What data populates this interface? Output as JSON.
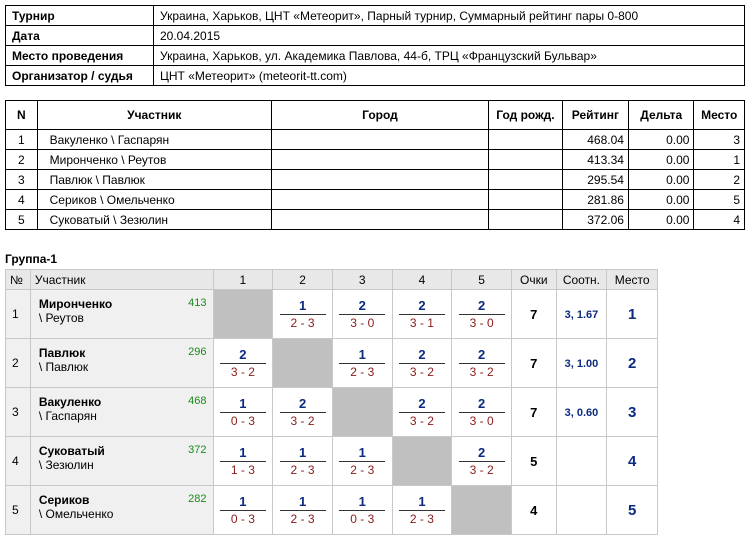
{
  "info": [
    {
      "label": "Турнир",
      "value": "Украина, Харьков, ЦНТ «Метеорит», Парный турнир, Суммарный рейтинг пары 0-800"
    },
    {
      "label": "Дата",
      "value": "20.04.2015"
    },
    {
      "label": "Место проведения",
      "value": "Украина, Харьков, ул. Академика Павлова, 44-б, ТРЦ «Французский Бульвар»"
    },
    {
      "label": "Организатор / судья",
      "value": "ЦНТ «Метеорит» (meteorit-tt.com)"
    }
  ],
  "participants": {
    "headers": [
      "N",
      "Участник",
      "Город",
      "Год рожд.",
      "Рейтинг",
      "Дельта",
      "Место"
    ],
    "rows": [
      {
        "n": "1",
        "name": "Вакуленко \\ Гаспарян",
        "city": "",
        "year": "",
        "rating": "468.04",
        "delta": "0.00",
        "place": "3"
      },
      {
        "n": "2",
        "name": "Миронченко \\ Реутов",
        "city": "",
        "year": "",
        "rating": "413.34",
        "delta": "0.00",
        "place": "1"
      },
      {
        "n": "3",
        "name": "Павлюк \\ Павлюк",
        "city": "",
        "year": "",
        "rating": "295.54",
        "delta": "0.00",
        "place": "2"
      },
      {
        "n": "4",
        "name": "Сериков \\ Омельченко",
        "city": "",
        "year": "",
        "rating": "281.86",
        "delta": "0.00",
        "place": "5"
      },
      {
        "n": "5",
        "name": "Суковатый \\ Зезюлин",
        "city": "",
        "year": "",
        "rating": "372.06",
        "delta": "0.00",
        "place": "4"
      }
    ]
  },
  "group": {
    "title": "Группа-1",
    "headers": [
      "№",
      "Участник",
      "1",
      "2",
      "3",
      "4",
      "5",
      "Очки",
      "Соотн.",
      "Место"
    ],
    "rows": [
      {
        "n": "1",
        "surname": "Миронченко",
        "partner": "\\ Реутов",
        "rating": "413",
        "results": [
          null,
          {
            "w": "1",
            "s": "2 - 3"
          },
          {
            "w": "2",
            "s": "3 - 0"
          },
          {
            "w": "2",
            "s": "3 - 1"
          },
          {
            "w": "2",
            "s": "3 - 0"
          }
        ],
        "points": "7",
        "ratio": "3, 1.67",
        "place": "1"
      },
      {
        "n": "2",
        "surname": "Павлюк",
        "partner": "\\ Павлюк",
        "rating": "296",
        "results": [
          {
            "w": "2",
            "s": "3 - 2"
          },
          null,
          {
            "w": "1",
            "s": "2 - 3"
          },
          {
            "w": "2",
            "s": "3 - 2"
          },
          {
            "w": "2",
            "s": "3 - 2"
          }
        ],
        "points": "7",
        "ratio": "3, 1.00",
        "place": "2"
      },
      {
        "n": "3",
        "surname": "Вакуленко",
        "partner": "\\ Гаспарян",
        "rating": "468",
        "results": [
          {
            "w": "1",
            "s": "0 - 3"
          },
          {
            "w": "2",
            "s": "3 - 2"
          },
          null,
          {
            "w": "2",
            "s": "3 - 2"
          },
          {
            "w": "2",
            "s": "3 - 0"
          }
        ],
        "points": "7",
        "ratio": "3, 0.60",
        "place": "3"
      },
      {
        "n": "4",
        "surname": "Суковатый",
        "partner": "\\ Зезюлин",
        "rating": "372",
        "results": [
          {
            "w": "1",
            "s": "1 - 3"
          },
          {
            "w": "1",
            "s": "2 - 3"
          },
          {
            "w": "1",
            "s": "2 - 3"
          },
          null,
          {
            "w": "2",
            "s": "3 - 2"
          }
        ],
        "points": "5",
        "ratio": "",
        "place": "4"
      },
      {
        "n": "5",
        "surname": "Сериков",
        "partner": "\\ Омельченко",
        "rating": "282",
        "results": [
          {
            "w": "1",
            "s": "0 - 3"
          },
          {
            "w": "1",
            "s": "2 - 3"
          },
          {
            "w": "1",
            "s": "0 - 3"
          },
          {
            "w": "1",
            "s": "2 - 3"
          },
          null
        ],
        "points": "4",
        "ratio": "",
        "place": "5"
      }
    ]
  }
}
